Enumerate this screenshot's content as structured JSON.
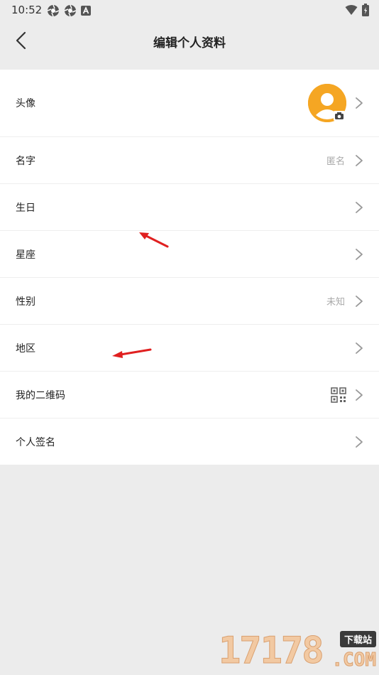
{
  "status_bar": {
    "time": "10:52"
  },
  "header": {
    "title": "编辑个人资料"
  },
  "rows": [
    {
      "label": "头像",
      "value": ""
    },
    {
      "label": "名字",
      "value": "匿名"
    },
    {
      "label": "生日",
      "value": ""
    },
    {
      "label": "星座",
      "value": ""
    },
    {
      "label": "性别",
      "value": "未知"
    },
    {
      "label": "地区",
      "value": ""
    },
    {
      "label": "我的二维码",
      "value": ""
    },
    {
      "label": "个人签名",
      "value": ""
    }
  ],
  "colors": {
    "background": "#ececec",
    "list_background": "#ffffff",
    "avatar": "#f5a623",
    "annotation_arrow": "#e02020",
    "value_text": "#a9a9a9"
  },
  "watermark": {
    "digits": "17178",
    "badge": "下载站",
    "suffix": ".COM"
  }
}
